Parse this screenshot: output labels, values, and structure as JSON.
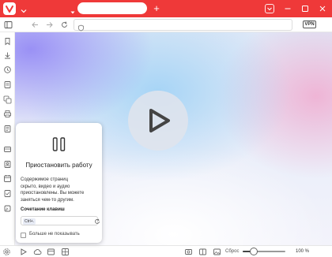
{
  "colors": {
    "titlebar": "#ef3939",
    "accent": "#ef3939"
  },
  "titlebar": {
    "new_tab_symbol": "+"
  },
  "addressbar": {
    "url_value": "",
    "vpn_label": "VPN"
  },
  "sidebar": {
    "icons": [
      "bookmarks-icon",
      "downloads-icon",
      "history-icon",
      "notes-icon",
      "translate-icon",
      "print-icon",
      "reading-list-icon",
      "mail-icon",
      "contacts-icon",
      "calendar-icon",
      "tasks-icon",
      "feeds-icon",
      "settings-icon"
    ]
  },
  "content": {
    "play_icon": "play-icon"
  },
  "popup": {
    "title": "Приостановить работу",
    "description_lines": [
      "Содержимое страниц",
      "скрыто, видео и аудио",
      "приостановлены. Вы можете",
      "заняться чем-то другим."
    ],
    "shortcut_label": "Сочетание клавиш",
    "shortcut_value": "Ctrl+.",
    "dont_show_label": "Больше не показывать"
  },
  "statusbar": {
    "reset_label": "Сброс",
    "zoom_value": "100 %",
    "zoom_fraction": 0.25
  }
}
